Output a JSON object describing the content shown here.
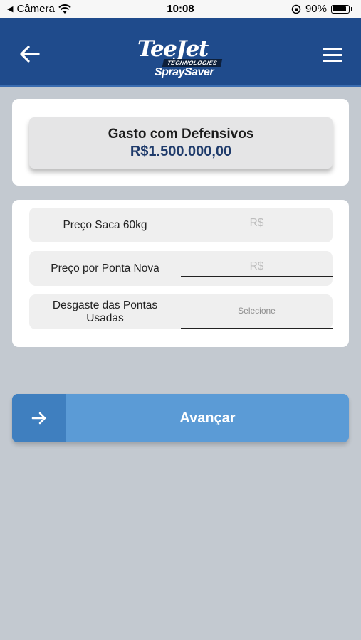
{
  "status_bar": {
    "back_app": "Câmera",
    "time": "10:08",
    "battery": "90%"
  },
  "header": {
    "logo_main": "TeeJet",
    "logo_tech": "TECHNOLOGIES",
    "logo_sub": "SpraySaver",
    "back_icon": "arrow-left-icon",
    "menu_icon": "hamburger-menu-icon"
  },
  "summary": {
    "title": "Gasto com Defensivos",
    "value": "R$1.500.000,00"
  },
  "form": {
    "fields": [
      {
        "label": "Preço Saca 60kg",
        "placeholder": "R$",
        "value": ""
      },
      {
        "label": "Preço por Ponta Nova",
        "placeholder": "R$",
        "value": ""
      },
      {
        "label": "Desgaste das Pontas Usadas",
        "placeholder": "Selecione"
      }
    ]
  },
  "advance_button": {
    "label": "Avançar",
    "icon": "arrow-right-icon"
  },
  "colors": {
    "header_bg": "#1f4b8c",
    "page_bg": "#c3c9d0",
    "button_bg": "#5b9bd6",
    "button_icon_bg": "#3f7fbf",
    "summary_value": "#1f3b6b"
  }
}
